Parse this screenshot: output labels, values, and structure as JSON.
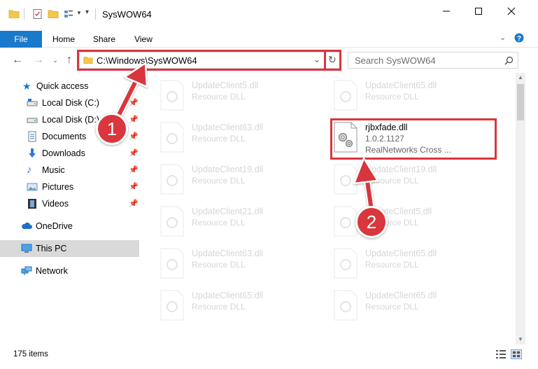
{
  "window": {
    "title": "SysWOW64",
    "minimize_icon": "minimize-icon",
    "maximize_icon": "maximize-icon",
    "close_icon": "close-icon"
  },
  "ribbon": {
    "tabs": [
      "File",
      "Home",
      "Share",
      "View"
    ],
    "help_icon": "help-icon",
    "expand_icon": "chevron-down-icon"
  },
  "address": {
    "path": "C:\\Windows\\SysWOW64",
    "search_placeholder": "Search SysWOW64"
  },
  "nav": {
    "items": [
      {
        "label": "Quick access",
        "icon": "star-icon"
      },
      {
        "label": "Local Disk (C:)",
        "icon": "drive-icon"
      },
      {
        "label": "Local Disk (D:)",
        "icon": "drive-icon"
      },
      {
        "label": "Documents",
        "icon": "documents-icon"
      },
      {
        "label": "Downloads",
        "icon": "downloads-icon"
      },
      {
        "label": "Music",
        "icon": "music-icon"
      },
      {
        "label": "Pictures",
        "icon": "pictures-icon"
      },
      {
        "label": "Videos",
        "icon": "videos-icon"
      },
      {
        "label": "OneDrive",
        "icon": "cloud-icon"
      },
      {
        "label": "This PC",
        "icon": "computer-icon"
      },
      {
        "label": "Network",
        "icon": "network-icon"
      }
    ]
  },
  "files": [
    {
      "name": "UpdateClient5.dll",
      "desc": "Resource DLL"
    },
    {
      "name": "UpdateClient65.dll",
      "desc": "Resource DLL"
    },
    {
      "name": "UpdateClient63.dll",
      "desc": "Resource DLL"
    },
    {
      "name": "rjbxfade.dll",
      "desc": "1.0.2.1127",
      "desc2": "RealNetworks Cross ..."
    },
    {
      "name": "UpdateClient19.dll",
      "desc": "Resource DLL"
    },
    {
      "name": "UpdateClient19.dll",
      "desc": "Resource DLL"
    },
    {
      "name": "UpdateClient21.dll",
      "desc": "Resource DLL"
    },
    {
      "name": "UpdateClient5.dll",
      "desc": "Resource DLL"
    },
    {
      "name": "UpdateClient63.dll",
      "desc": "Resource DLL"
    },
    {
      "name": "UpdateClient65.dll",
      "desc": "Resource DLL"
    },
    {
      "name": "UpdateClient65.dll",
      "desc": "Resource DLL"
    },
    {
      "name": "UpdateClient65.dll",
      "desc": "Resource DLL"
    }
  ],
  "status": {
    "item_count": "175 items"
  },
  "callouts": [
    "1",
    "2"
  ],
  "colors": {
    "file_tab": "#1979ca",
    "highlight": "#d9363e",
    "selected_nav": "#d9d9d9"
  }
}
